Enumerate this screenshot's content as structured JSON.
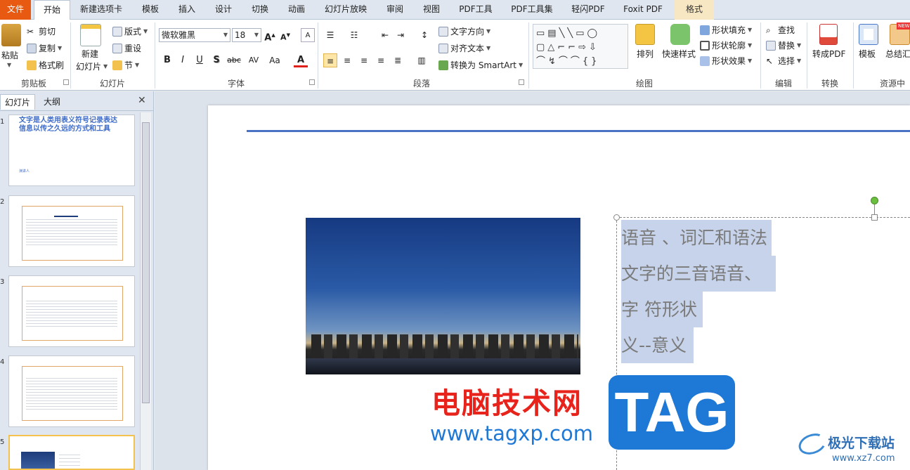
{
  "tabs": [
    "文件",
    "开始",
    "新建选项卡",
    "模板",
    "插入",
    "设计",
    "切换",
    "动画",
    "幻灯片放映",
    "审阅",
    "视图",
    "PDF工具",
    "PDF工具集",
    "轻闪PDF",
    "Foxit PDF",
    "格式"
  ],
  "clipboard": {
    "paste": "粘贴",
    "cut": "剪切",
    "copy": "复制",
    "format_painter": "格式刷",
    "label": "剪贴板"
  },
  "slides_group": {
    "new_slide": "新建",
    "new_slide2": "幻灯片",
    "layout": "版式",
    "reset": "重设",
    "section": "节",
    "label": "幻灯片"
  },
  "font": {
    "name": "微软雅黑",
    "size": "18",
    "label": "字体",
    "bold": "B",
    "italic": "I",
    "underline": "U",
    "shadow": "S",
    "strike": "abc",
    "spacing": "AV",
    "case": "Aa",
    "color": "A"
  },
  "paragraph": {
    "text_direction": "文字方向",
    "align_text": "对齐文本",
    "smartart": "转换为 SmartArt",
    "label": "段落"
  },
  "drawing": {
    "arrange": "排列",
    "quick_styles": "快速样式",
    "shape_fill": "形状填充",
    "shape_outline": "形状轮廓",
    "shape_effects": "形状效果",
    "label": "绘图"
  },
  "editing": {
    "find": "查找",
    "replace": "替换",
    "select": "选择",
    "label": "编辑"
  },
  "convert": {
    "to_pdf": "转成PDF",
    "label": "转换"
  },
  "resources": {
    "template": "模板",
    "summary": "总结汇",
    "label": "资源中",
    "new_badge": "NEW"
  },
  "panel": {
    "tab_slides": "幻灯片",
    "tab_outline": "大纲",
    "close": "✕"
  },
  "thumbnails": [
    {
      "num": "1",
      "title": "文字是人类用表义符号记录表达信息以传之久远的方式和工具",
      "sub": "演讲人"
    },
    {
      "num": "2"
    },
    {
      "num": "3"
    },
    {
      "num": "4"
    },
    {
      "num": "5"
    }
  ],
  "slide": {
    "lines": [
      "语音 、词汇和语法",
      "文字的三音语音、",
      "字 符形状",
      "义--意义"
    ]
  },
  "watermark": {
    "site_cn": "电脑技术网",
    "site_url": "www.tagxp.com",
    "tag": "TAG",
    "brand": "极光下载站",
    "brand_url": "www.xz7.com"
  },
  "colors": {
    "accent": "#e85a12",
    "slide_rule": "#4a72c4",
    "selection": "#c6d3ea",
    "watermark_red": "#e8231c",
    "watermark_blue": "#1e78d6"
  }
}
